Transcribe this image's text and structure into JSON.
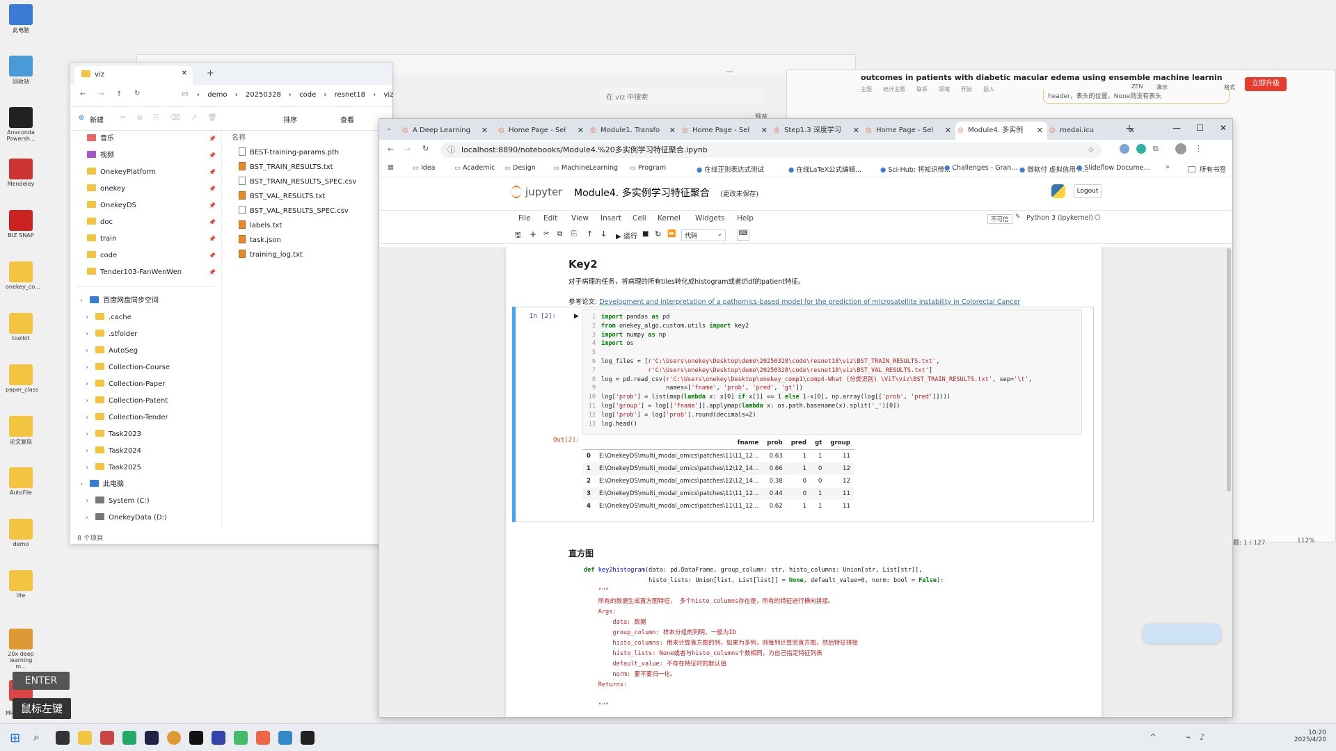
{
  "desktop": {
    "icons": [
      "此电脑",
      "回收站",
      "Anaconda Powersh...",
      "Mendeley",
      "BIZ SNAP",
      "onekey_co...",
      "toolkit",
      "paper_class",
      "论文复现",
      "AutoFile",
      "demo",
      "lite",
      "20x deep learning m...",
      "报告 Microsoft..."
    ],
    "overlay_enter": "ENTER",
    "overlay_mouse": "鼠标左键"
  },
  "back_window": {
    "title": "outcomes in patients with diabetic macular edema using ensemble machine learning",
    "tools": [
      "主题",
      "统计主题",
      "联系",
      "领域",
      "开始",
      "插入"
    ],
    "right_tools": [
      "ZEN",
      "演示",
      "格式"
    ],
    "upgrade": "立即升级",
    "note": "header，表头的位置，None则没有表头",
    "status_page": "主题: 1 / 127",
    "status_zoom": "112%",
    "preview": "预览"
  },
  "explorer": {
    "tab_title": "viz",
    "breadcrumb": [
      "demo",
      "20250328",
      "code",
      "resnet18",
      "viz"
    ],
    "search_placeholder": "在 viz 中搜索",
    "cmd_new": "新建",
    "cmd_sort": "排序",
    "cmd_view": "查看",
    "column_name": "名称",
    "quick": [
      "音乐",
      "视频",
      "OnekeyPlatform",
      "onekey",
      "OnekeyDS",
      "doc",
      "train",
      "code",
      "Tender103-FanWenWen"
    ],
    "sync_root": "百度网盘同步空间",
    "sync": [
      ".cache",
      ".stfolder",
      "AutoSeg",
      "Collection-Course",
      "Collection-Paper",
      "Collection-Patent",
      "Collection-Tender",
      "Task2023",
      "Task2024",
      "Task2025"
    ],
    "pc": "此电脑",
    "drives": [
      "System (C:)",
      "OnekeyData (D:)"
    ],
    "files": [
      "BEST-training-params.pth",
      "BST_TRAIN_RESULTS.txt",
      "BST_TRAIN_RESULTS_SPEC.csv",
      "BST_VAL_RESULTS.txt",
      "BST_VAL_RESULTS_SPEC.csv",
      "labels.txt",
      "task.json",
      "training_log.txt"
    ],
    "status": "8 个项目"
  },
  "browser": {
    "tabs": [
      "A Deep Learning",
      "Home Page - Sel",
      "Module1. Transfo",
      "Home Page - Sel",
      "Step1.3 深度学习",
      "Home Page - Sel",
      "Module4. 多实例",
      "medai.icu"
    ],
    "url": "localhost:8890/notebooks/Module4.%20多实例学习特征聚合.ipynb",
    "bookmarks": [
      "Idea",
      "Academic",
      "Design",
      "MachineLearning",
      "Program",
      "在线正则表达式测试",
      "在线LaTeX公式编辑...",
      "Sci-Hub: 将知识带...",
      "Challenges - Gran...",
      "微软付 虚拟信用卡...",
      "Slideflow Docume..."
    ],
    "bookmarks_all": "所有书签"
  },
  "jupyter": {
    "brand": "jupyter",
    "notebook_title": "Module4. 多实例学习特征聚合",
    "save_status": "(更改未保存)",
    "logout": "Logout",
    "menus": [
      "File",
      "Edit",
      "View",
      "Insert",
      "Cell",
      "Kernel",
      "Widgets",
      "Help"
    ],
    "trusted": "不可信",
    "kernel": "Python 3 (ipykernel)",
    "run_label": "运行",
    "celltype": "代码",
    "key2_heading": "Key2",
    "key2_desc": "对于病理的任务，将病理的所有tiles转化成histogram或者tfidf的patient特征。",
    "ref_label": "参考论文:",
    "ref_link": "Development and interpretation of a pathomics-based model for the prediction of microsatellite instability in Colorectal Cancer",
    "in_prompt": "In [2]:",
    "out_prompt": "Out[2]:",
    "df_headers": [
      "",
      "fname",
      "prob",
      "pred",
      "gt",
      "group"
    ],
    "df_rows": [
      [
        "0",
        "E:\\OnekeyDS\\multi_modal_omics\\patches\\11\\11_12...",
        "0.63",
        "1",
        "1",
        "11"
      ],
      [
        "1",
        "E:\\OnekeyDS\\multi_modal_omics\\patches\\12\\12_14...",
        "0.66",
        "1",
        "0",
        "12"
      ],
      [
        "2",
        "E:\\OnekeyDS\\multi_modal_omics\\patches\\12\\12_14...",
        "0.38",
        "0",
        "0",
        "12"
      ],
      [
        "3",
        "E:\\OnekeyDS\\multi_modal_omics\\patches\\11\\11_12...",
        "0.44",
        "0",
        "1",
        "11"
      ],
      [
        "4",
        "E:\\OnekeyDS\\multi_modal_omics\\patches\\11\\11_12...",
        "0.62",
        "1",
        "1",
        "11"
      ]
    ],
    "hist_heading": "直方图"
  },
  "taskbar": {
    "time": "10:20",
    "date": "2025/4/20"
  }
}
